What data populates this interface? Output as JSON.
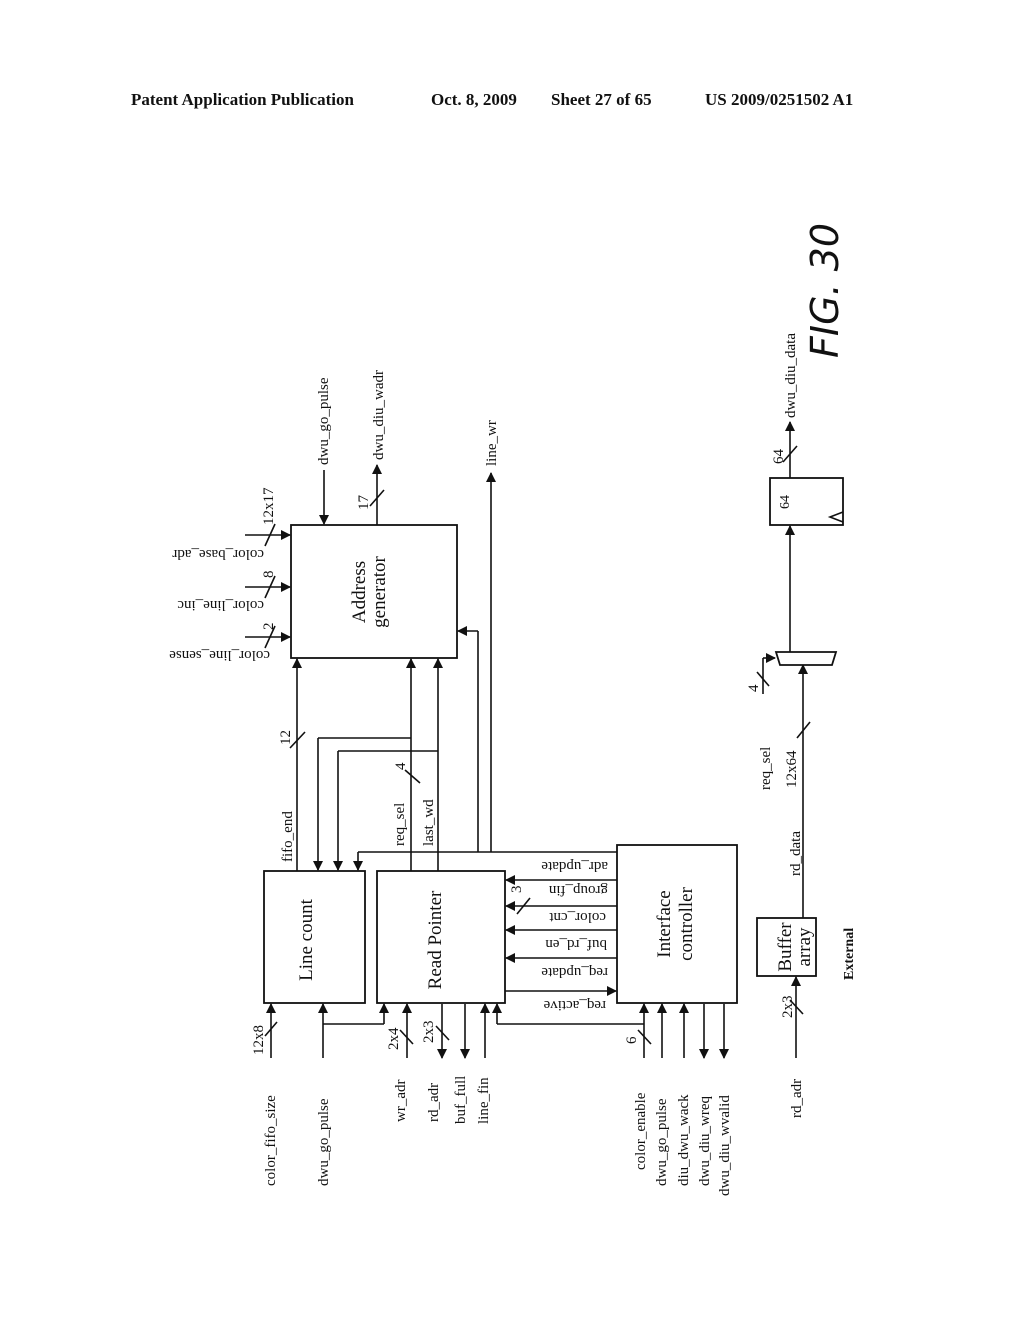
{
  "header": {
    "publication": "Patent Application Publication",
    "date": "Oct. 8, 2009",
    "sheet": "Sheet 27 of 65",
    "number": "US 2009/0251502 A1"
  },
  "figure": {
    "label": "FIG. 30",
    "blocks": {
      "address_generator": [
        "Address",
        "generator"
      ],
      "line_count": "Line count",
      "read_pointer": "Read Pointer",
      "interface_controller": [
        "Interface",
        "controller"
      ],
      "buffer_array": [
        "Buffer",
        "array"
      ],
      "external": "External",
      "register_width": "64"
    },
    "address_generator_inputs": [
      {
        "name": "color_base_adr",
        "width": "12x17"
      },
      {
        "name": "color_line_inc",
        "width": "8"
      },
      {
        "name": "color_line_sense",
        "width": "2"
      }
    ],
    "address_generator_top": {
      "dwu_go_pulse": "dwu_go_pulse",
      "dwu_diu_wadr": "dwu_diu_wadr",
      "wadr_width": "17",
      "line_wr": "line_wr"
    },
    "internal_signals": {
      "fifo_end": "fifo_end",
      "fifo_end_width": "12",
      "req_sel": "req_sel",
      "req_sel_width": "4",
      "last_wd": "last_wd"
    },
    "controller_signals": [
      {
        "name": "adr_update"
      },
      {
        "name": "group_fin"
      },
      {
        "name": "color_cnt",
        "width": "3"
      },
      {
        "name": "buf_rd_en"
      },
      {
        "name": "req_update"
      },
      {
        "name": "req_active"
      }
    ],
    "bottom_signals": {
      "line_count": [
        {
          "name": "color_fifo_size",
          "width": "12x8"
        },
        {
          "name": "dwu_go_pulse"
        }
      ],
      "read_pointer": [
        {
          "name": "wr_adr",
          "width": "2x4"
        },
        {
          "name": "rd_adr",
          "width": "2x3"
        },
        {
          "name": "buf_full"
        },
        {
          "name": "line_fin"
        }
      ],
      "interface_controller": [
        {
          "name": "color_enable",
          "width": "6"
        },
        {
          "name": "dwu_go_pulse"
        },
        {
          "name": "diu_dwu_wack"
        },
        {
          "name": "dwu_diu_wreq"
        },
        {
          "name": "dwu_diu_wvalid"
        }
      ]
    },
    "datapath": {
      "rd_adr": "rd_adr",
      "rd_adr_width": "2x3",
      "rd_data": "rd_data",
      "rd_data_width": "12x64",
      "req_sel": "req_sel",
      "req_sel_width": "4",
      "output": "dwu_diu_data",
      "output_width": "64"
    }
  }
}
